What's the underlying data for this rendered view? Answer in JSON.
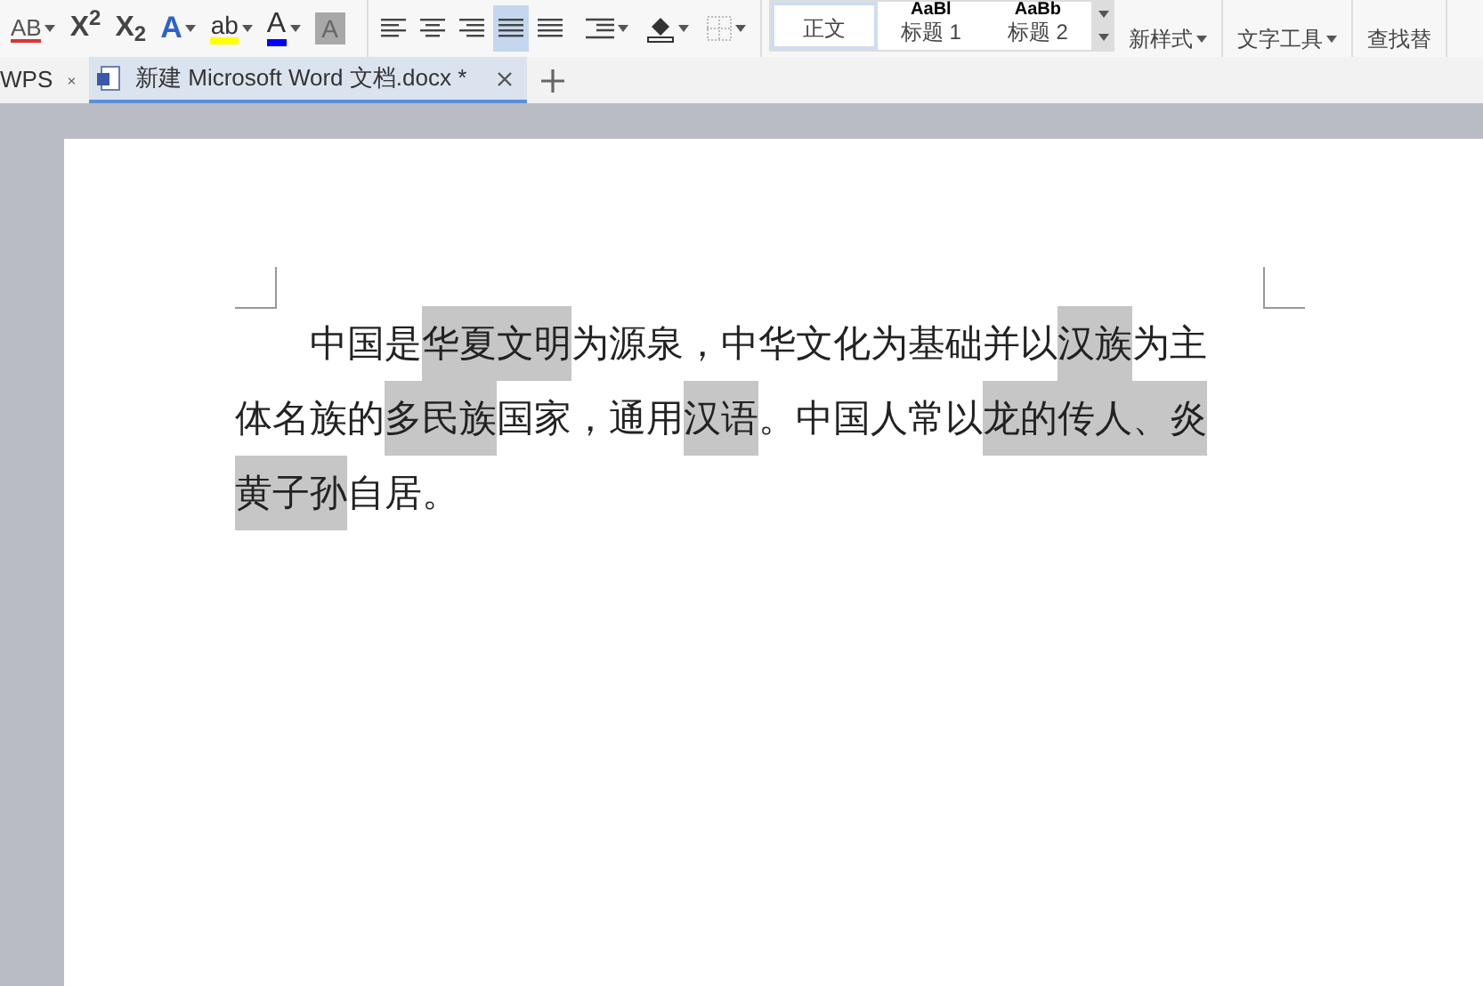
{
  "toolbar": {
    "font_buttons": [
      {
        "kind": "strike",
        "label": "AB",
        "caret": true
      },
      {
        "kind": "plain",
        "label": "X$^{2}$",
        "caret": false
      },
      {
        "kind": "plain",
        "label": "X$_{2}$",
        "caret": false
      },
      {
        "kind": "effect",
        "label": "A",
        "caret": true
      },
      {
        "kind": "highlight",
        "label": "ab",
        "caret": true
      },
      {
        "kind": "fontcolor",
        "label": "A",
        "caret": true
      },
      {
        "kind": "shade",
        "label": "A",
        "caret": false
      }
    ],
    "align_buttons": [
      {
        "kind": "left",
        "selected": false
      },
      {
        "kind": "center",
        "selected": false
      },
      {
        "kind": "right",
        "selected": false
      },
      {
        "kind": "justify",
        "selected": true
      },
      {
        "kind": "distributed",
        "selected": false
      }
    ],
    "styles": [
      {
        "label": "正文",
        "selected": true
      },
      {
        "preview": "AaBl",
        "label": "标题 1",
        "selected": false
      },
      {
        "preview": "AaBb",
        "label": "标题 2",
        "selected": false
      }
    ],
    "menus": [
      {
        "label": "新样式",
        "caret": true
      },
      {
        "label": "文字工具",
        "caret": true
      },
      {
        "label": "查找替",
        "caret": false
      }
    ]
  },
  "tabs": [
    {
      "label": "WPS",
      "selected": false,
      "doc_icon": false
    },
    {
      "label": "新建 Microsoft Word 文档.docx *",
      "selected": true,
      "doc_icon": true
    }
  ],
  "document": {
    "lines": [
      {
        "indent": true,
        "runs": [
          {
            "text": "中国是",
            "shaded": false
          },
          {
            "text": "华夏文明",
            "shaded": true
          },
          {
            "text": "为源泉，中华文化为基础并以",
            "shaded": false
          },
          {
            "text": "汉族",
            "shaded": true
          },
          {
            "text": "为主",
            "shaded": false
          }
        ]
      },
      {
        "indent": false,
        "runs": [
          {
            "text": "体名族的",
            "shaded": false
          },
          {
            "text": "多民族",
            "shaded": true
          },
          {
            "text": "国家，通用",
            "shaded": false
          },
          {
            "text": "汉语",
            "shaded": true
          },
          {
            "text": "。中国人常以",
            "shaded": false
          },
          {
            "text": "龙的传人、炎",
            "shaded": true
          }
        ]
      },
      {
        "indent": false,
        "runs": [
          {
            "text": "黄子孙",
            "shaded": true
          },
          {
            "text": "自居。",
            "shaded": false
          }
        ]
      }
    ]
  }
}
